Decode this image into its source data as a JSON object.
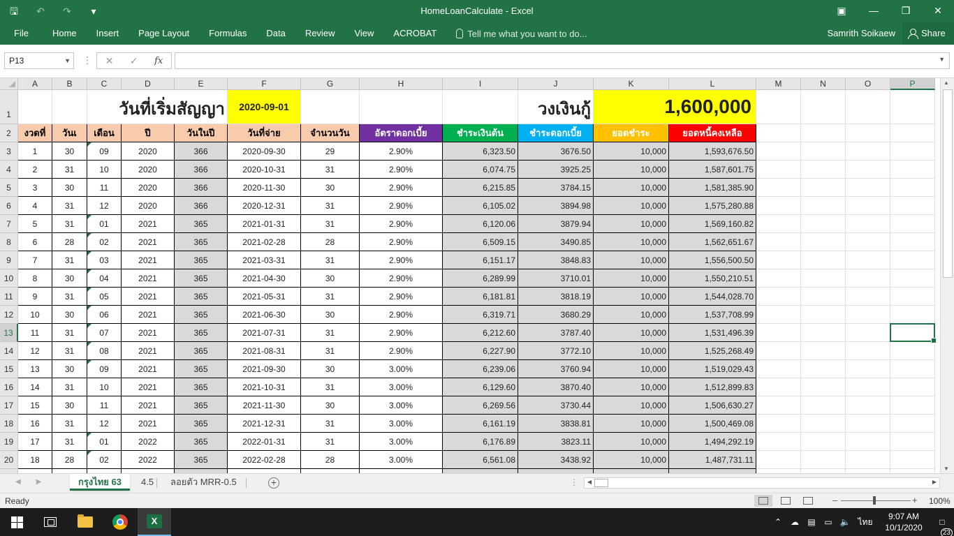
{
  "titlebar": {
    "title": "HomeLoanCalculate - Excel",
    "qat": [
      "save-icon",
      "undo-icon",
      "redo-icon",
      "customize-icon"
    ],
    "window_buttons": [
      "ribbon-display-icon",
      "minimize-icon",
      "restore-icon",
      "close-icon"
    ]
  },
  "ribbon": {
    "tabs": [
      "File",
      "Home",
      "Insert",
      "Page Layout",
      "Formulas",
      "Data",
      "Review",
      "View",
      "ACROBAT"
    ],
    "tell_me": "Tell me what you want to do...",
    "user": "Samrith Soikaew",
    "share": "Share"
  },
  "formula_bar": {
    "name_box": "P13",
    "formula": "",
    "fx": "fx"
  },
  "sheet": {
    "columns": [
      "A",
      "B",
      "C",
      "D",
      "E",
      "F",
      "G",
      "H",
      "I",
      "J",
      "K",
      "L",
      "M",
      "N",
      "O",
      "P"
    ],
    "selected_column": "P",
    "selected_row": 13,
    "row1": {
      "contract_label": "วันที่เริ่มสัญญา",
      "contract_date": "2020-09-01",
      "loan_label": "วงเงินกู้",
      "loan_amount": "1,600,000"
    },
    "headers": [
      "งวดที่",
      "วันเ",
      "เดือน",
      "ปี",
      "วันในปี",
      "วันที่จ่าย",
      "จำนวนวัน",
      "อัตราดอกเบี้ย",
      "ชำระเงินต้น",
      "ชำระดอกเบี้ย",
      "ยอดชำระ",
      "ยอดหนี้คงเหลือ"
    ],
    "header_colors": {
      "default": "#f8cbad",
      "H": "#7030a0",
      "I": "#00b050",
      "J": "#00b0f0",
      "K": "#ffc000",
      "L": "#ff0000"
    },
    "highlight_yellow": "#ffff00",
    "rows": [
      [
        "1",
        "30",
        "09",
        "2020",
        "366",
        "2020-09-30",
        "29",
        "2.90%",
        "6,323.50",
        "3676.50",
        "10,000",
        "1,593,676.50"
      ],
      [
        "2",
        "31",
        "10",
        "2020",
        "366",
        "2020-10-31",
        "31",
        "2.90%",
        "6,074.75",
        "3925.25",
        "10,000",
        "1,587,601.75"
      ],
      [
        "3",
        "30",
        "11",
        "2020",
        "366",
        "2020-11-30",
        "30",
        "2.90%",
        "6,215.85",
        "3784.15",
        "10,000",
        "1,581,385.90"
      ],
      [
        "4",
        "31",
        "12",
        "2020",
        "366",
        "2020-12-31",
        "31",
        "2.90%",
        "6,105.02",
        "3894.98",
        "10,000",
        "1,575,280.88"
      ],
      [
        "5",
        "31",
        "01",
        "2021",
        "365",
        "2021-01-31",
        "31",
        "2.90%",
        "6,120.06",
        "3879.94",
        "10,000",
        "1,569,160.82"
      ],
      [
        "6",
        "28",
        "02",
        "2021",
        "365",
        "2021-02-28",
        "28",
        "2.90%",
        "6,509.15",
        "3490.85",
        "10,000",
        "1,562,651.67"
      ],
      [
        "7",
        "31",
        "03",
        "2021",
        "365",
        "2021-03-31",
        "31",
        "2.90%",
        "6,151.17",
        "3848.83",
        "10,000",
        "1,556,500.50"
      ],
      [
        "8",
        "30",
        "04",
        "2021",
        "365",
        "2021-04-30",
        "30",
        "2.90%",
        "6,289.99",
        "3710.01",
        "10,000",
        "1,550,210.51"
      ],
      [
        "9",
        "31",
        "05",
        "2021",
        "365",
        "2021-05-31",
        "31",
        "2.90%",
        "6,181.81",
        "3818.19",
        "10,000",
        "1,544,028.70"
      ],
      [
        "10",
        "30",
        "06",
        "2021",
        "365",
        "2021-06-30",
        "30",
        "2.90%",
        "6,319.71",
        "3680.29",
        "10,000",
        "1,537,708.99"
      ],
      [
        "11",
        "31",
        "07",
        "2021",
        "365",
        "2021-07-31",
        "31",
        "2.90%",
        "6,212.60",
        "3787.40",
        "10,000",
        "1,531,496.39"
      ],
      [
        "12",
        "31",
        "08",
        "2021",
        "365",
        "2021-08-31",
        "31",
        "2.90%",
        "6,227.90",
        "3772.10",
        "10,000",
        "1,525,268.49"
      ],
      [
        "13",
        "30",
        "09",
        "2021",
        "365",
        "2021-09-30",
        "30",
        "3.00%",
        "6,239.06",
        "3760.94",
        "10,000",
        "1,519,029.43"
      ],
      [
        "14",
        "31",
        "10",
        "2021",
        "365",
        "2021-10-31",
        "31",
        "3.00%",
        "6,129.60",
        "3870.40",
        "10,000",
        "1,512,899.83"
      ],
      [
        "15",
        "30",
        "11",
        "2021",
        "365",
        "2021-11-30",
        "30",
        "3.00%",
        "6,269.56",
        "3730.44",
        "10,000",
        "1,506,630.27"
      ],
      [
        "16",
        "31",
        "12",
        "2021",
        "365",
        "2021-12-31",
        "31",
        "3.00%",
        "6,161.19",
        "3838.81",
        "10,000",
        "1,500,469.08"
      ],
      [
        "17",
        "31",
        "01",
        "2022",
        "365",
        "2022-01-31",
        "31",
        "3.00%",
        "6,176.89",
        "3823.11",
        "10,000",
        "1,494,292.19"
      ],
      [
        "18",
        "28",
        "02",
        "2022",
        "365",
        "2022-02-28",
        "28",
        "3.00%",
        "6,561.08",
        "3438.92",
        "10,000",
        "1,487,731.11"
      ]
    ]
  },
  "sheet_tabs": [
    "กรุงไทย 63",
    "4.5",
    "ลอยตัว MRR-0.5"
  ],
  "active_sheet": "กรุงไทย 63",
  "status": {
    "ready": "Ready",
    "zoom": "100%"
  },
  "taskbar": {
    "apps": [
      "windows-start-icon",
      "task-view-icon",
      "file-explorer-icon",
      "chrome-icon",
      "excel-icon"
    ],
    "language": "ไทย",
    "time": "9:07 AM",
    "date": "10/1/2020",
    "notifications": "23"
  }
}
